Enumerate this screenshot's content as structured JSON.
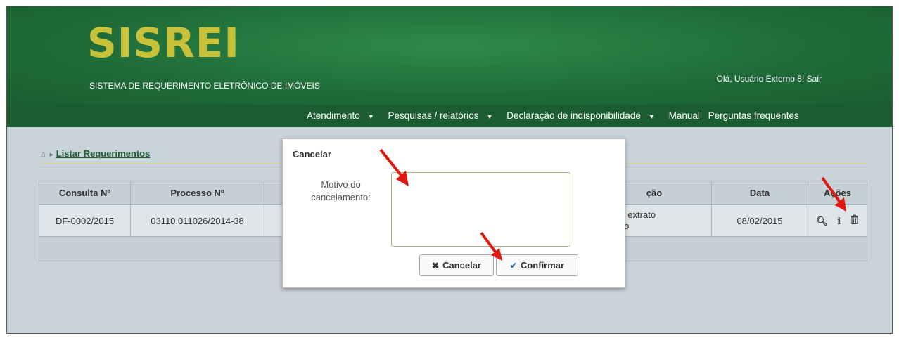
{
  "app": {
    "logo": "SISREI",
    "subtitle": "SISTEMA DE REQUERIMENTO ELETRÔNICO DE IMÓVEIS",
    "greeting": "Olá, Usuário Externo 8!",
    "logout": "Sair"
  },
  "nav": {
    "items": [
      {
        "label": "Atendimento",
        "dropdown": true
      },
      {
        "label": "Pesquisas / relatórios",
        "dropdown": true
      },
      {
        "label": "Declaração de indisponibilidade",
        "dropdown": true
      },
      {
        "label": "Manual",
        "dropdown": false
      },
      {
        "label": "Perguntas frequentes",
        "dropdown": false
      }
    ]
  },
  "breadcrumb": {
    "current": "Listar Requerimentos"
  },
  "table": {
    "headers": [
      "Consulta Nº",
      "Processo Nº",
      "",
      "ção",
      "Data",
      "Ações"
    ],
    "row": {
      "consulta": "DF-0002/2015",
      "processo": "03110.011026/2014-38",
      "situacao_line1": "vio do extrato",
      "situacao_line2": "licação",
      "data": "08/02/2015"
    }
  },
  "modal": {
    "title": "Cancelar",
    "label_line1": "Motivo do",
    "label_line2": "cancelamento:",
    "textarea_value": "",
    "cancel_label": "Cancelar",
    "confirm_label": "Confirmar"
  },
  "colors": {
    "header_green": "#1f6b38",
    "logo_yellow": "#c8c23a",
    "annotation_red": "#e0180f"
  },
  "icons": [
    "home-icon",
    "zoom-in-icon",
    "info-icon",
    "trash-icon",
    "close-icon",
    "check-icon",
    "red-arrow-annotation"
  ]
}
